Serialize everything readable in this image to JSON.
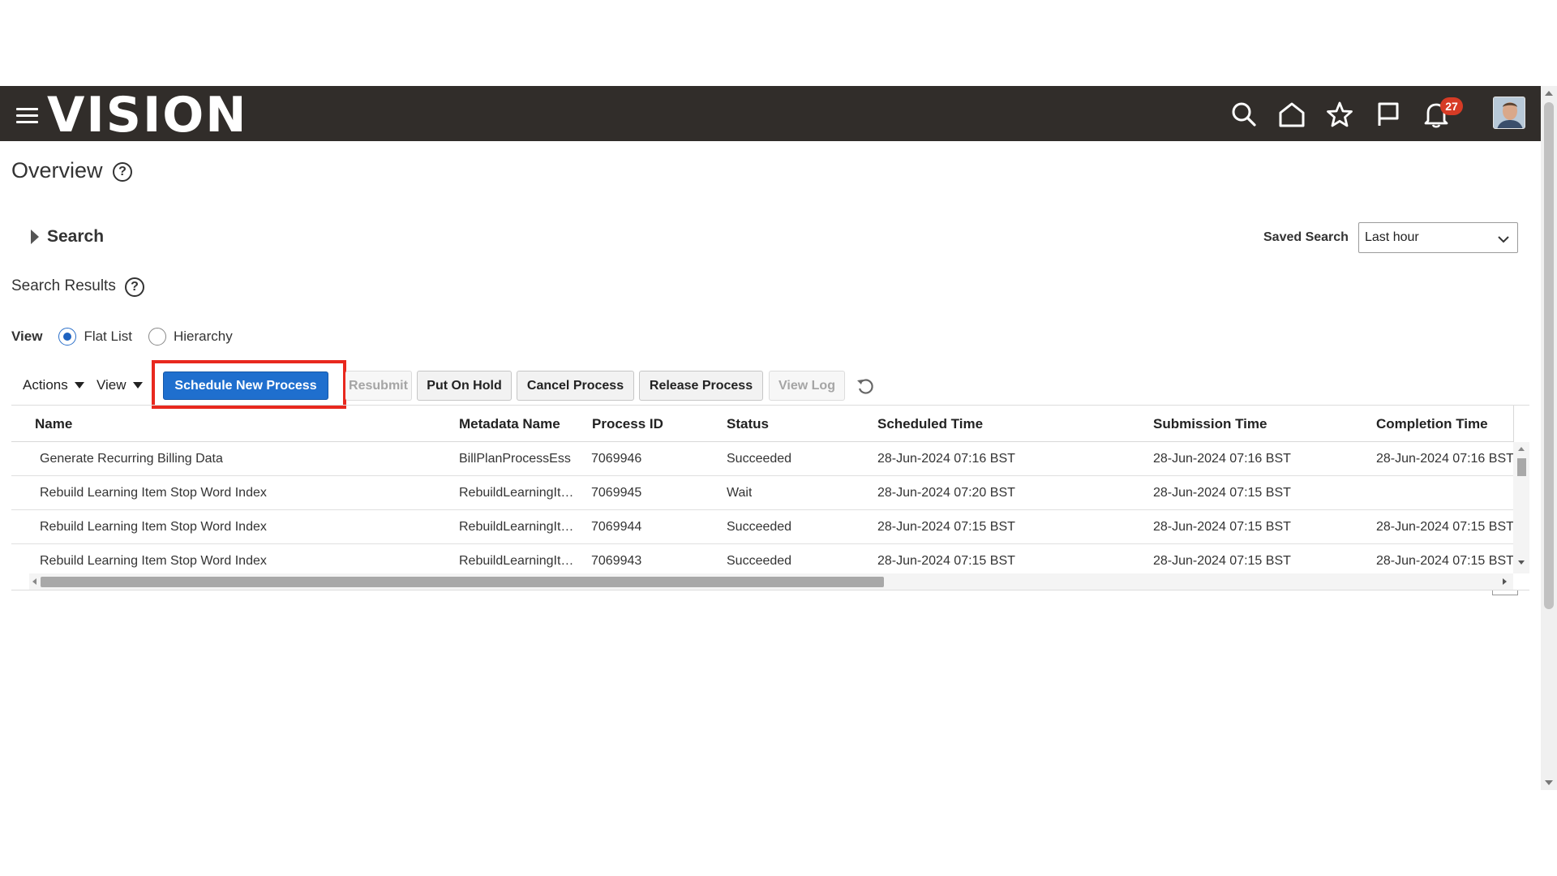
{
  "header": {
    "logo": "VISION",
    "notifications_count": "27",
    "icons": [
      "menu-icon",
      "search-icon",
      "home-icon",
      "favorites-star-icon",
      "flag-icon",
      "bell-icon",
      "user-avatar"
    ]
  },
  "page": {
    "title": "Overview",
    "help": "?"
  },
  "search": {
    "label": "Search",
    "saved_search_label": "Saved Search",
    "saved_search_value": "Last hour"
  },
  "results": {
    "label": "Search Results",
    "help": "?"
  },
  "view_mode": {
    "label": "View",
    "options": [
      "Flat List",
      "Hierarchy"
    ],
    "selected": "Flat List"
  },
  "toolbar": {
    "actions": "Actions",
    "view": "View",
    "schedule": "Schedule New Process",
    "resubmit": "Resubmit",
    "put_on_hold": "Put On Hold",
    "cancel": "Cancel Process",
    "release": "Release Process",
    "view_log": "View Log"
  },
  "table": {
    "columns": [
      "Name",
      "Metadata Name",
      "Process ID",
      "Status",
      "Scheduled Time",
      "Submission Time",
      "Completion Time"
    ],
    "rows": [
      {
        "name": "Generate Recurring Billing Data",
        "metadata": "BillPlanProcessEss",
        "pid": "7069946",
        "status": "Succeeded",
        "scheduled": "28-Jun-2024 07:16 BST",
        "submitted": "28-Jun-2024 07:16 BST",
        "completed": "28-Jun-2024 07:16 BST"
      },
      {
        "name": "Rebuild Learning Item Stop Word Index",
        "metadata": "RebuildLearningIt…",
        "pid": "7069945",
        "status": "Wait",
        "scheduled": "28-Jun-2024 07:20 BST",
        "submitted": "28-Jun-2024 07:15 BST",
        "completed": ""
      },
      {
        "name": "Rebuild Learning Item Stop Word Index",
        "metadata": "RebuildLearningIt…",
        "pid": "7069944",
        "status": "Succeeded",
        "scheduled": "28-Jun-2024 07:15 BST",
        "submitted": "28-Jun-2024 07:15 BST",
        "completed": "28-Jun-2024 07:15 BST"
      },
      {
        "name": "Rebuild Learning Item Stop Word Index",
        "metadata": "RebuildLearningIt…",
        "pid": "7069943",
        "status": "Succeeded",
        "scheduled": "28-Jun-2024 07:15 BST",
        "submitted": "28-Jun-2024 07:15 BST",
        "completed": "28-Jun-2024 07:15 BST"
      }
    ]
  },
  "colors": {
    "header_bg": "#312d2a",
    "primary_button": "#1f6fce",
    "highlight_box": "#e8281e",
    "badge": "#d63b25"
  }
}
